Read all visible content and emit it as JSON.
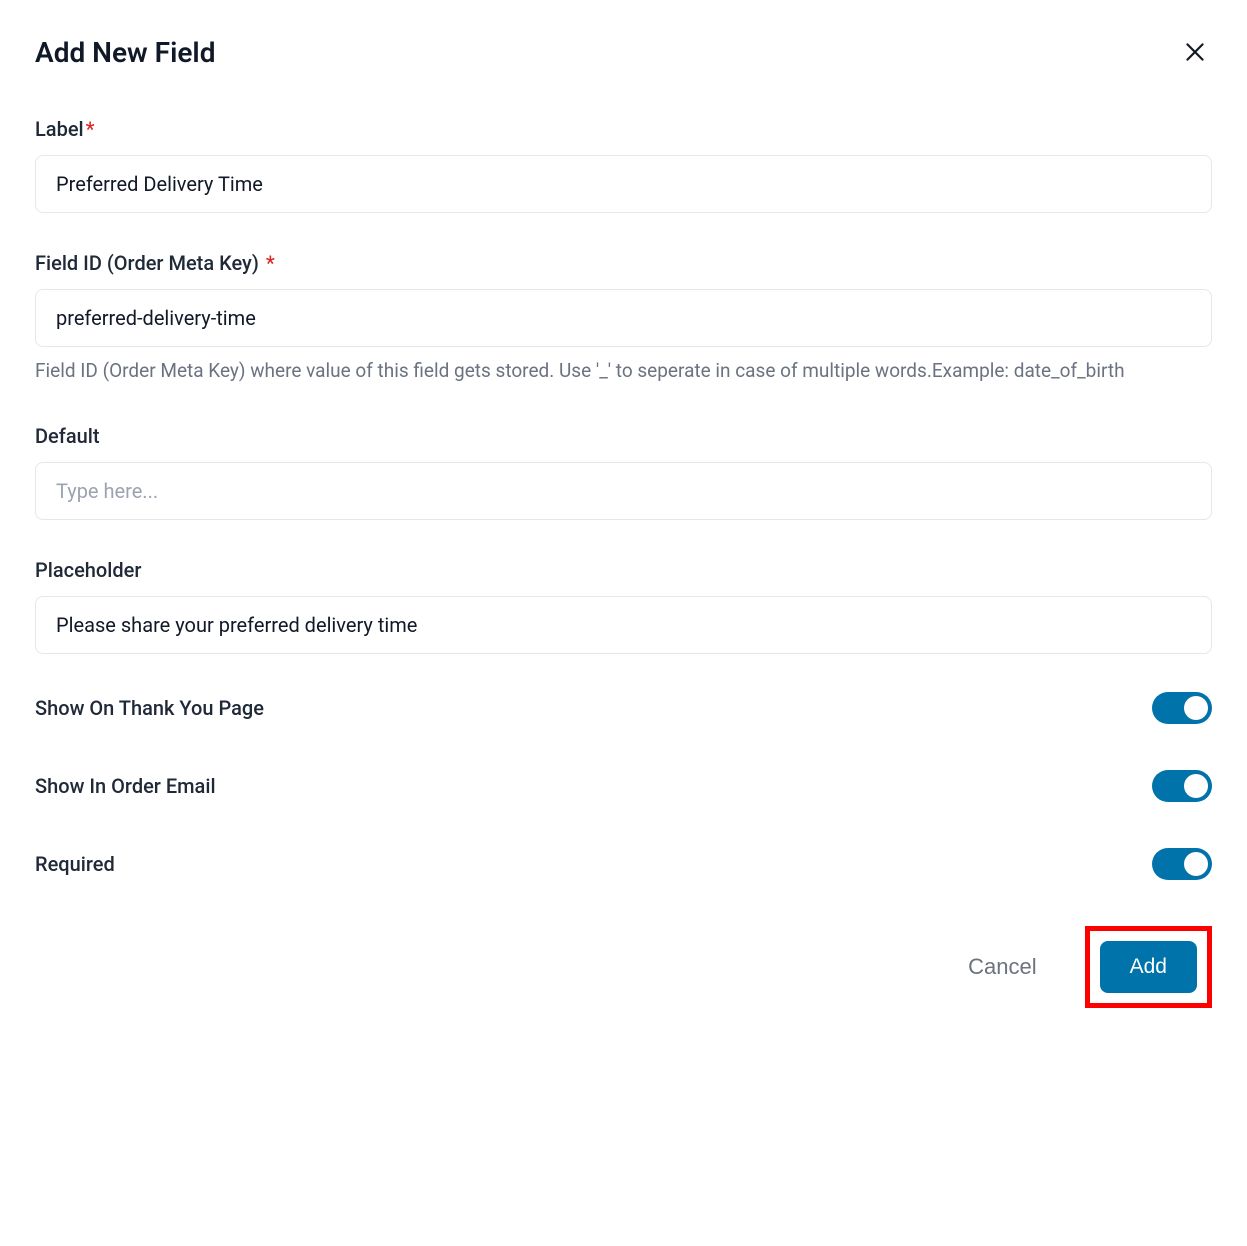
{
  "header": {
    "title": "Add New Field"
  },
  "form": {
    "label": {
      "label": "Label",
      "required": true,
      "value": "Preferred Delivery Time"
    },
    "field_id": {
      "label": "Field ID (Order Meta Key)",
      "required": true,
      "value": "preferred-delivery-time",
      "help": "Field ID (Order Meta Key) where value of this field gets stored. Use '_' to seperate in case of multiple words.Example: date_of_birth"
    },
    "default": {
      "label": "Default",
      "value": "",
      "placeholder": "Type here..."
    },
    "placeholder": {
      "label": "Placeholder",
      "value": "Please share your preferred delivery time"
    },
    "toggles": {
      "thank_you": {
        "label": "Show On Thank You Page",
        "value": true
      },
      "order_email": {
        "label": "Show In Order Email",
        "value": true
      },
      "required": {
        "label": "Required",
        "value": true
      }
    }
  },
  "footer": {
    "cancel": "Cancel",
    "add": "Add"
  }
}
